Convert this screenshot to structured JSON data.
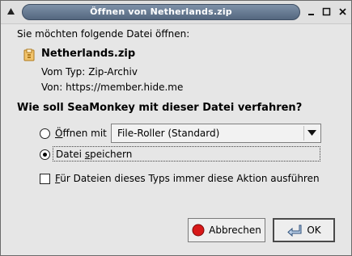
{
  "window": {
    "title": "Öffnen von Netherlands.zip"
  },
  "dialog": {
    "prompt": "Sie möchten folgende Datei öffnen:",
    "file_name": "Netherlands.zip",
    "type_label": "Vom Typ:",
    "type_value": "Zip-Archiv",
    "from_label": "Von:",
    "from_value": "https://member.hide.me",
    "question": "Wie soll SeaMonkey mit dieser Datei verfahren?"
  },
  "options": {
    "open_with": {
      "label_first": "Ö",
      "label_rest": "ffnen mit",
      "selected": false
    },
    "app_select": {
      "value": "File-Roller (Standard)"
    },
    "save_file": {
      "label_first": "Datei ",
      "label_mnemonic": "s",
      "label_rest": "peichern",
      "selected": true
    },
    "always": {
      "label_first": "F",
      "label_rest": "ür Dateien dieses Typs immer diese Aktion ausführen",
      "checked": false
    }
  },
  "buttons": {
    "cancel": {
      "label": "Abbrechen",
      "icon": "stop-icon"
    },
    "ok": {
      "label": "OK",
      "icon": "enter-arrow-icon"
    }
  },
  "colors": {
    "titlebar_start": "#7e91a8",
    "titlebar_end": "#54677f",
    "stop_red": "#d81818"
  }
}
